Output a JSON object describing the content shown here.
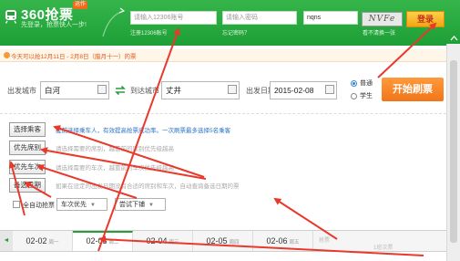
{
  "header": {
    "logo_text": "360抢票",
    "logo_badge": "运作",
    "slogan": "先登录，抢票快人一步!",
    "username_placeholder": "请输入12306账号",
    "username_sub": "注册12306账号",
    "password_placeholder": "请输入密码",
    "password_sub": "忘记密码？",
    "captcha_value": "nqns",
    "captcha_image_text": "NVFe",
    "captcha_sub": "看不清换一张",
    "login_label": "登录"
  },
  "notice": {
    "text": "今天可以抢12月11日 - 2月8日（腊月十一）的票"
  },
  "route": {
    "from_label": "出发城市",
    "from_value": "白河",
    "to_label": "到达城市",
    "to_value": "丈井",
    "date_label": "出发日期",
    "date_value": "2015-02-08",
    "ticket_type_normal": "普通",
    "ticket_type_student": "学生",
    "start_label": "开始刷票"
  },
  "options": [
    {
      "button": "选择乘客",
      "desc": "提前选择乘车人，有效提高抢票成功率。一次刷票最多选择5名乘客"
    },
    {
      "button": "优先席别",
      "desc": "请选择需要的席别，越靠前的席别优先级越高"
    },
    {
      "button": "优先车次",
      "desc": "请选择需要的车次，越靠前的车次优先级越高"
    },
    {
      "button": "备选日期",
      "desc": "如果在设定的出发日期没有合适的席别和车次，自动查询备选日期的票"
    }
  ],
  "bottom": {
    "auto_label": "全自动抢票",
    "priority_select": "车次优先",
    "retry_select": "尝试下铺"
  },
  "dates": {
    "prev_icon": "◄",
    "tabs": [
      {
        "date": "02-02",
        "week": "周一"
      },
      {
        "date": "02-03",
        "week": "周二"
      },
      {
        "date": "02-04",
        "week": "周三"
      },
      {
        "date": "02-05",
        "week": "周四"
      },
      {
        "date": "02-06",
        "week": "周五"
      }
    ],
    "extra_1": "抢票",
    "extra_2": "1班次票"
  },
  "colors": {
    "header_green": "#1e9f37",
    "accent_orange": "#f0761a",
    "annotation_red": "#e8392b",
    "link_blue": "#2a74c9"
  },
  "icons": [
    "train-logo-icon",
    "swap-icon",
    "calendar-icon",
    "notice-icon",
    "chevron-left-icon",
    "scroll-up-icon"
  ]
}
